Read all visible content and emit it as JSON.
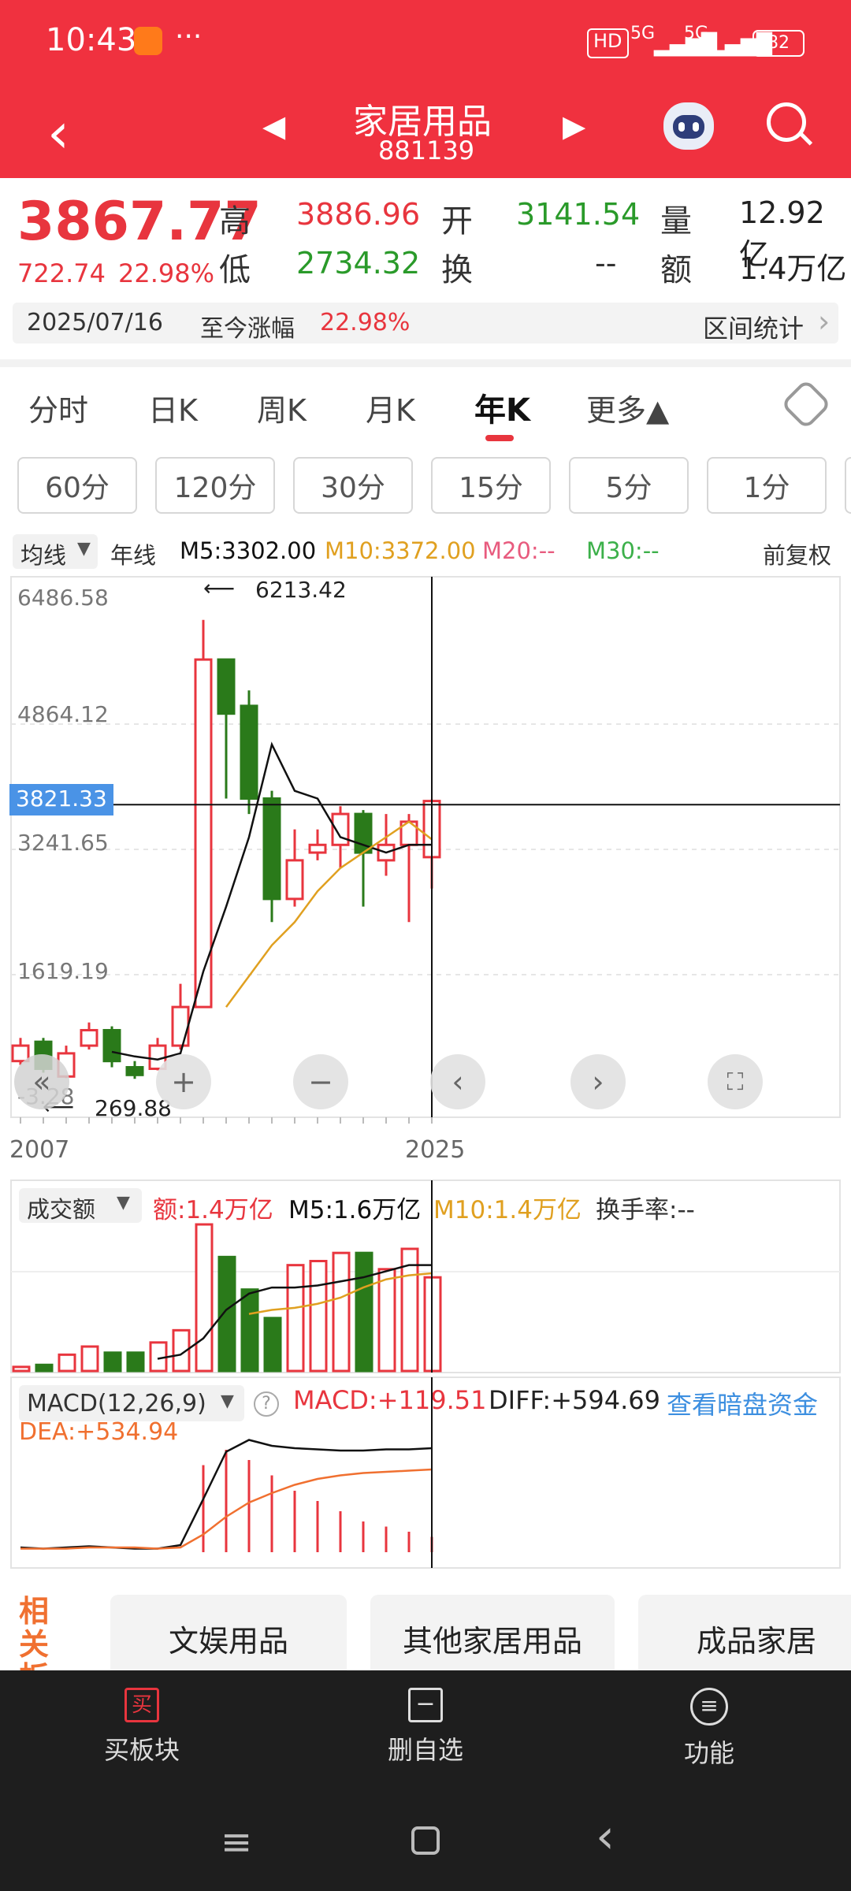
{
  "status": {
    "time": "10:43",
    "dots": "···",
    "hd": "HD",
    "sig1": "5G",
    "sig2": "5G",
    "battery": "82"
  },
  "header": {
    "title": "家居用品",
    "code": "881139"
  },
  "quote": {
    "price": "3867.77",
    "change": "722.74",
    "change_pct": "22.98%",
    "high_label": "高",
    "high": "3886.96",
    "low_label": "低",
    "low": "2734.32",
    "open_label": "开",
    "open": "3141.54",
    "turnover_label": "换",
    "turnover": "--",
    "volume_label": "量",
    "volume": "12.92亿",
    "amount_label": "额",
    "amount": "1.4万亿"
  },
  "range_bar": {
    "date": "2025/07/16",
    "label": "至今涨幅",
    "value": "22.98%",
    "stats": "区间统计"
  },
  "tabs": [
    "分时",
    "日K",
    "周K",
    "月K",
    "年K",
    "更多▲"
  ],
  "periods": [
    "60分",
    "120分",
    "30分",
    "15分",
    "5分",
    "1分"
  ],
  "ma_legend": {
    "dropdown": "均线",
    "type": "年线",
    "m5": "M5:3302.00",
    "m10": "M10:3372.00",
    "m20": "M20:--",
    "m30": "M30:--",
    "adjust": "前复权"
  },
  "chart_data": {
    "type": "candlestick",
    "y_ticks": [
      "6486.58",
      "4864.12",
      "3241.65",
      "1619.19",
      "-3.28"
    ],
    "ylim": [
      -3.28,
      6486.58
    ],
    "crosshair_value": "3821.33",
    "max_label": "6213.42",
    "min_label": "269.88",
    "x_labels": [
      "2007",
      "2025"
    ],
    "candles": [
      {
        "o": 500,
        "c": 700,
        "h": 800,
        "l": 450
      },
      {
        "o": 750,
        "c": 400,
        "h": 800,
        "l": 350
      },
      {
        "o": 300,
        "c": 600,
        "h": 700,
        "l": 280
      },
      {
        "o": 700,
        "c": 900,
        "h": 1000,
        "l": 650
      },
      {
        "o": 900,
        "c": 500,
        "h": 950,
        "l": 420
      },
      {
        "o": 420,
        "c": 320,
        "h": 500,
        "l": 270
      },
      {
        "o": 400,
        "c": 700,
        "h": 800,
        "l": 380
      },
      {
        "o": 700,
        "c": 1200,
        "h": 1500,
        "l": 650
      },
      {
        "o": 1200,
        "c": 5700,
        "h": 6213,
        "l": 1200
      },
      {
        "o": 5700,
        "c": 5000,
        "h": 5700,
        "l": 3900
      },
      {
        "o": 5100,
        "c": 3900,
        "h": 5300,
        "l": 3700
      },
      {
        "o": 3900,
        "c": 2600,
        "h": 4000,
        "l": 2300
      },
      {
        "o": 2600,
        "c": 3100,
        "h": 3500,
        "l": 2500
      },
      {
        "o": 3200,
        "c": 3300,
        "h": 3500,
        "l": 3100
      },
      {
        "o": 3300,
        "c": 3700,
        "h": 3800,
        "l": 3000
      },
      {
        "o": 3700,
        "c": 3200,
        "h": 3750,
        "l": 2500
      },
      {
        "o": 3100,
        "c": 3300,
        "h": 3700,
        "l": 2900
      },
      {
        "o": 3300,
        "c": 3600,
        "h": 3700,
        "l": 2300
      },
      {
        "o": 3141,
        "c": 3868,
        "h": 3887,
        "l": 2734
      }
    ],
    "ma5": [
      null,
      null,
      null,
      null,
      620,
      560,
      520,
      600,
      1660,
      2500,
      3400,
      4600,
      4000,
      3900,
      3400,
      3300,
      3200,
      3300,
      3302
    ],
    "ma10": [
      null,
      null,
      null,
      null,
      null,
      null,
      null,
      null,
      null,
      1200,
      1600,
      2000,
      2300,
      2700,
      3000,
      3200,
      3400,
      3600,
      3372
    ],
    "volume": {
      "label": "成交额",
      "amount": "额:1.4万亿",
      "m5": "M5:1.6万亿",
      "m10": "M10:1.4万亿",
      "turnover": "换手率:--",
      "bars": [
        0.1,
        0.15,
        0.4,
        0.6,
        0.45,
        0.45,
        0.7,
        1.0,
        3.6,
        2.8,
        2.0,
        1.3,
        2.6,
        2.7,
        2.9,
        2.9,
        2.5,
        3.0,
        2.3
      ],
      "colors": [
        "r",
        "g",
        "r",
        "r",
        "g",
        "g",
        "r",
        "r",
        "r",
        "g",
        "g",
        "g",
        "r",
        "r",
        "r",
        "g",
        "r",
        "r",
        "r"
      ]
    },
    "macd": {
      "label": "MACD(12,26,9)",
      "macd": "MACD:+119.51",
      "diff": "DIFF:+594.69",
      "dea": "DEA:+534.94",
      "link": "查看暗盘资金",
      "hist": [
        0,
        0,
        0,
        0,
        0,
        0,
        0,
        0,
        0.85,
        1.0,
        0.9,
        0.75,
        0.6,
        0.5,
        0.4,
        0.3,
        0.25,
        0.2,
        0.15
      ]
    }
  },
  "controls": {
    "back": "«",
    "plus": "+",
    "minus": "−",
    "left": "‹",
    "right": "›",
    "fullscreen": "⛶"
  },
  "related": {
    "label": "相关板",
    "items": [
      "文娱用品",
      "其他家居用品",
      "成品家居"
    ]
  },
  "bottom": {
    "buy": "买板块",
    "delete": "删自选",
    "func": "功能"
  },
  "colors": {
    "header": "#f0313f",
    "up": "#e8353e",
    "down": "#2a7a1a",
    "ma5": "#111111",
    "ma10": "#e0a020",
    "accent": "#3d8fe0"
  }
}
